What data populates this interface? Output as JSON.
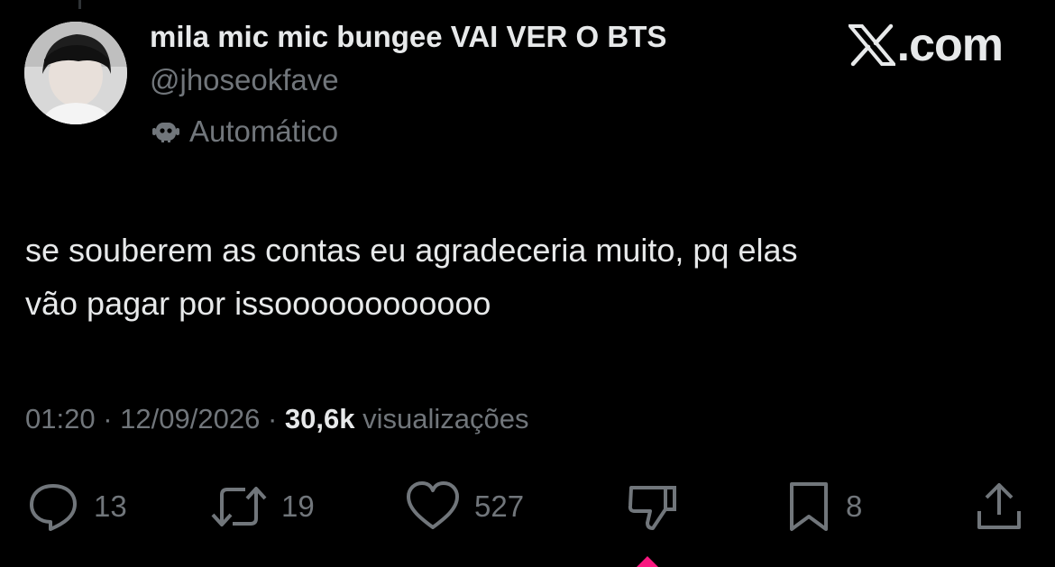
{
  "header": {
    "display_name": "mila mic mic bungee VAI VER O BTS",
    "handle": "@jhoseokfave",
    "automated_label": "Automático",
    "brand": ".com"
  },
  "tweet": {
    "lines": [
      "se souberem as contas eu agradeceria muito, pq elas",
      "vão pagar por issoooooooooooo"
    ]
  },
  "meta": {
    "time": "01:20",
    "separator": "·",
    "date": "12/09/2026",
    "views_count": "30,6k",
    "views_label": "visualizações"
  },
  "actions": {
    "replies": "13",
    "reposts": "19",
    "likes": "527",
    "bookmarks": "8"
  },
  "icons": [
    "bot-icon",
    "x-logo-icon",
    "reply-icon",
    "repost-icon",
    "like-icon",
    "dislike-icon",
    "bookmark-icon",
    "share-icon"
  ],
  "colors": {
    "background": "#000000",
    "text": "#e7e9ea",
    "muted": "#71767b"
  }
}
